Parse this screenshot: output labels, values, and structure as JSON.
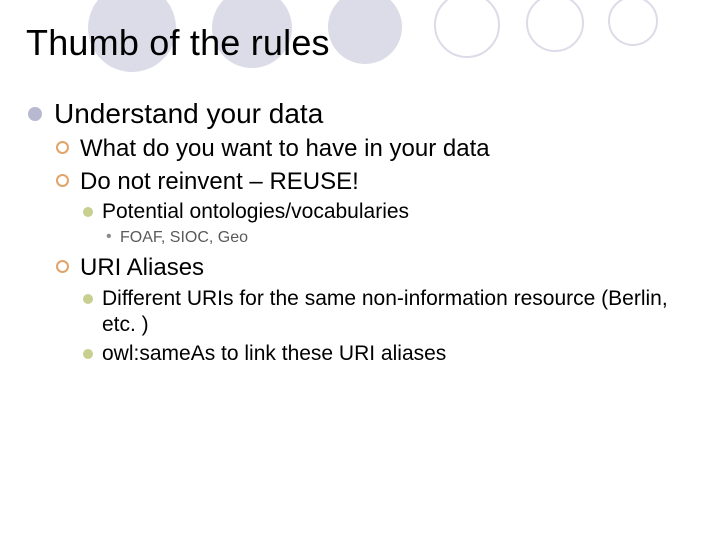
{
  "title": "Thumb of the rules",
  "bullets": {
    "l1_1": "Understand your data",
    "l2_1": "What do you want to have in your data",
    "l2_2": "Do not reinvent – REUSE!",
    "l3_1": "Potential ontologies/vocabularies",
    "l4_1": "FOAF, SIOC, Geo",
    "l2_3": "URI Aliases",
    "l3_2": "Different URIs for the same non-information resource (Berlin, etc. )",
    "l3_3": "owl:sameAs to link these URI aliases"
  },
  "decor": {
    "circle_fill": "#dcdce9",
    "circle_stroke": "#dcdce9"
  }
}
